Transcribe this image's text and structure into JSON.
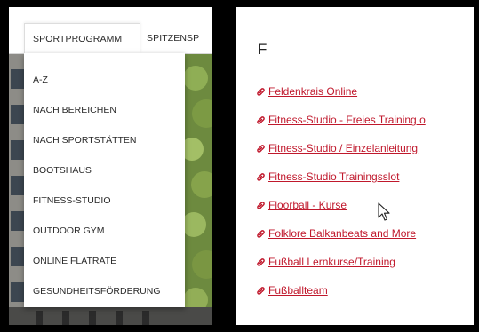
{
  "nav": {
    "tab_active": "SPORTPROGRAMM",
    "tab_next": "SPITZENSP"
  },
  "dropdown": {
    "items": [
      "A-Z",
      "NACH BEREICHEN",
      "NACH SPORTSTÄTTEN",
      "BOOTSHAUS",
      "FITNESS-STUDIO",
      "OUTDOOR GYM",
      "ONLINE FLATRATE",
      "GESUNDHEITSFÖRDERUNG"
    ]
  },
  "az_list": {
    "letter": "F",
    "links": [
      "Feldenkrais Online",
      "Fitness-Studio - Freies Training o",
      "Fitness-Studio / Einzelanleitung",
      "Fitness-Studio Trainingsslot",
      "Floorball - Kurse",
      "Folklore Balkanbeats and More",
      "Fußball Lernkurse/Training",
      "Fußballteam"
    ]
  },
  "colors": {
    "link": "#c0182c",
    "text": "#2a2a2a"
  },
  "icons": {
    "link": "link-icon",
    "cursor": "mouse-pointer-icon"
  }
}
